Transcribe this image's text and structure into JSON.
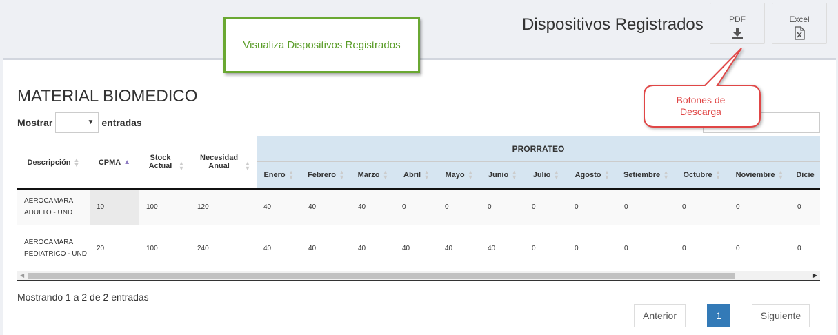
{
  "header": {
    "title": "Dispositivos Registrados",
    "pdf_label": "PDF",
    "excel_label": "Excel"
  },
  "annotations": {
    "green_box": "Visualiza Dispositivos Registrados",
    "callout_line1": "Botones de",
    "callout_line2": "Descarga",
    "callout_color": "#e04646",
    "green_color": "#6aa832"
  },
  "section": {
    "title": "MATERIAL BIOMEDICO",
    "show_label": "Mostrar",
    "entries_label": "entradas"
  },
  "table": {
    "headers": {
      "descripcion": "Descripción",
      "cpma": "CPMA",
      "stock": "Stock Actual",
      "necesidad": "Necesidad Anual",
      "prorrateo": "PRORRATEO"
    },
    "months": [
      "Enero",
      "Febrero",
      "Marzo",
      "Abril",
      "Mayo",
      "Junio",
      "Julio",
      "Agosto",
      "Setiembre",
      "Octubre",
      "Noviembre",
      "Dicie"
    ],
    "rows": [
      {
        "descripcion": "AEROCAMARA ADULTO - UND",
        "cpma": "10",
        "stock": "100",
        "necesidad": "120",
        "months": [
          "40",
          "40",
          "40",
          "0",
          "0",
          "0",
          "0",
          "0",
          "0",
          "0",
          "0",
          "0"
        ]
      },
      {
        "descripcion": "AEROCAMARA PEDIATRICO - UND",
        "cpma": "20",
        "stock": "100",
        "necesidad": "240",
        "months": [
          "40",
          "40",
          "40",
          "40",
          "40",
          "40",
          "0",
          "0",
          "0",
          "0",
          "0",
          "0"
        ]
      }
    ]
  },
  "footer": {
    "info": "Mostrando 1 a 2 de 2 entradas",
    "prev": "Anterior",
    "page": "1",
    "next": "Siguiente"
  }
}
